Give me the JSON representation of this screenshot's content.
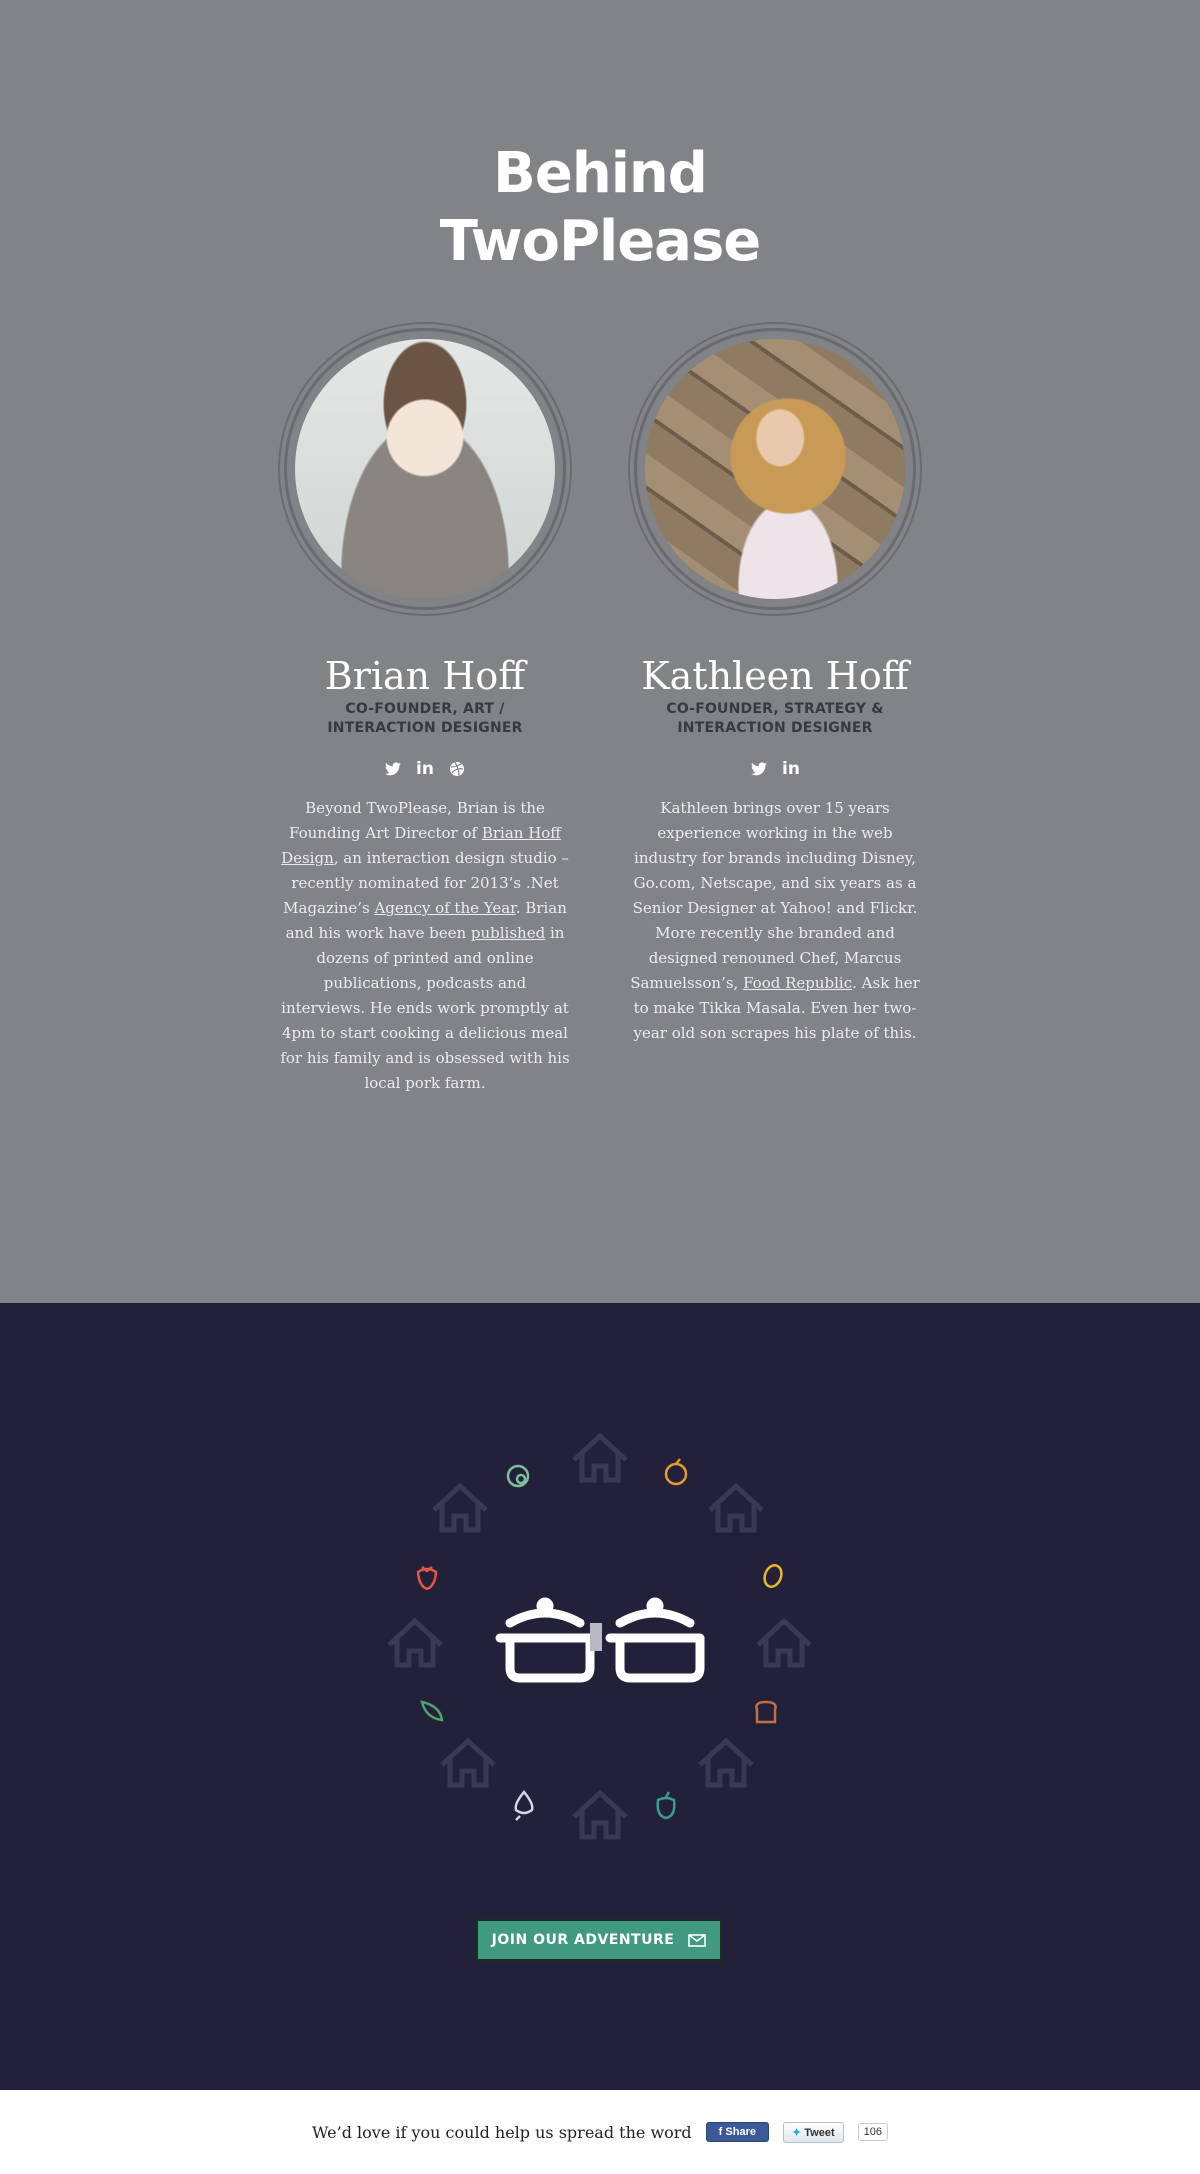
{
  "hero": {
    "title_line1": "Behind",
    "title_line2": "TwoPlease",
    "background": "#828387"
  },
  "people": [
    {
      "name": "Brian Hoff",
      "role_line1": "Co-Founder, Art /",
      "role_line2": "Interaction Designer",
      "socials": [
        "twitter-icon",
        "linkedin-icon",
        "dribbble-icon"
      ],
      "bio": {
        "p1": "Beyond TwoPlease, Brian is the Founding Art Director of ",
        "link1": "Brian Hoff Design",
        "p2": ", an interaction design studio – recently nominated for 2013’s .Net Magazine’s ",
        "link2": "Agency of the Year",
        "p3": ". Brian and his work have been ",
        "link3": "published",
        "p4": " in dozens of printed and online publications, podcasts and interviews. He ends work promptly at 4pm to start cooking a delicious meal for his family and is obsessed with his local pork farm."
      }
    },
    {
      "name": "Kathleen Hoff",
      "role_line1": "Co-Founder, Strategy &",
      "role_line2": "Interaction Designer",
      "socials": [
        "twitter-icon",
        "linkedin-icon"
      ],
      "bio": {
        "p1": "Kathleen brings over 15 years experience working in the web industry for brands including Disney, Go.com, Netscape, and six years as a Senior Designer at Yahoo! and Flickr. More recently she branded and designed renouned Chef, Marcus Samuelsson’s, ",
        "link1": "Food Republic",
        "p2": ". Ask her to make Tikka Masala. Even her two-year old son scrapes his plate of this."
      }
    }
  ],
  "band": {
    "background": "#23203a",
    "cta_label": "Join our adventure",
    "cta_color": "#3f9a7f",
    "food_icons": [
      "kiwi-icon",
      "orange-icon",
      "strawberry-icon",
      "lemon-icon",
      "pea-pod-icon",
      "bread-icon",
      "garlic-icon",
      "pepper-icon"
    ]
  },
  "footer": {
    "text": "We’d love if you could help us spread the word",
    "share_label": "Share",
    "tweet_label": "Tweet",
    "tweet_count": "106"
  }
}
